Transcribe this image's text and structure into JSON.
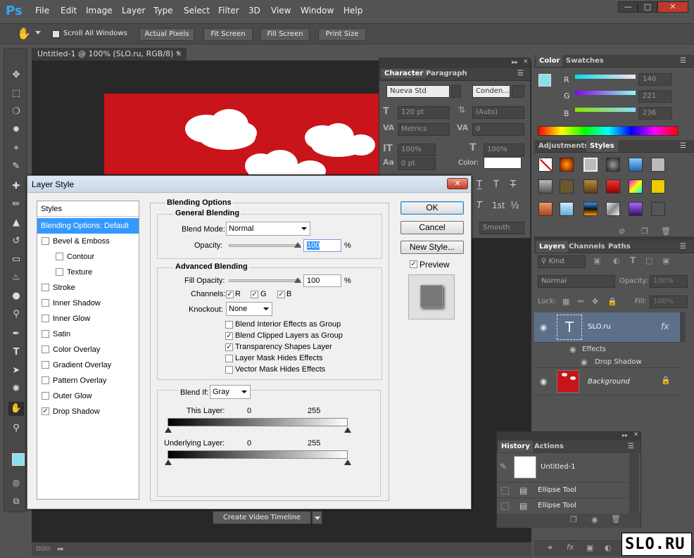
{
  "app": {
    "logo": "Ps",
    "menu": [
      "File",
      "Edit",
      "Image",
      "Layer",
      "Type",
      "Select",
      "Filter",
      "3D",
      "View",
      "Window",
      "Help"
    ]
  },
  "options_bar": {
    "scroll_all_label": "Scroll All Windows",
    "buttons": [
      "Actual Pixels",
      "Fit Screen",
      "Fill Screen",
      "Print Size"
    ]
  },
  "document": {
    "tab_title": "Untitled-1 @ 100% (SLO.ru, RGB/8) *",
    "create_video_label": "Create Video Timeline"
  },
  "character_panel": {
    "tabs": [
      "Character",
      "Paragraph"
    ],
    "font_family": "Nueva Std",
    "font_style": "Conden...",
    "size": "120 pt",
    "leading": "(Auto)",
    "kerning": "Metrics",
    "tracking": "0",
    "vscale": "100%",
    "hscale": "100%",
    "baseline": "0 pt",
    "color_label": "Color:",
    "smooth": "Smooth",
    "glyphs": [
      "T̲",
      "T",
      "T̶"
    ],
    "glyphs2": [
      "T",
      "1st",
      "½"
    ]
  },
  "color_panel": {
    "tabs": [
      "Color",
      "Swatches"
    ],
    "r_label": "R",
    "g_label": "G",
    "b_label": "B",
    "r": "140",
    "g": "221",
    "b": "236"
  },
  "styles_panel": {
    "tabs": [
      "Adjustments",
      "Styles"
    ]
  },
  "layers_panel": {
    "tabs": [
      "Layers",
      "Channels",
      "Paths"
    ],
    "kind": "Kind",
    "blend_mode": "Normal",
    "opacity_label": "Opacity:",
    "opacity": "100%",
    "lock_label": "Lock:",
    "fill_label": "Fill:",
    "fill": "100%",
    "layers": [
      {
        "name": "SLO.ru",
        "fx": "fx"
      },
      {
        "name": "Effects"
      },
      {
        "name": "Drop Shadow"
      },
      {
        "name": "Background"
      }
    ]
  },
  "history_panel": {
    "tabs": [
      "History",
      "Actions"
    ],
    "snapshot": "Untitled-1",
    "items": [
      "Ellipse Tool",
      "Ellipse Tool"
    ]
  },
  "dialog": {
    "title": "Layer Style",
    "styles_header": "Styles",
    "styles": [
      {
        "label": "Blending Options: Default",
        "checked": false,
        "selected": true,
        "checkbox": false
      },
      {
        "label": "Bevel & Emboss",
        "checked": false
      },
      {
        "label": "Contour",
        "checked": false,
        "indent": true
      },
      {
        "label": "Texture",
        "checked": false,
        "indent": true
      },
      {
        "label": "Stroke",
        "checked": false
      },
      {
        "label": "Inner Shadow",
        "checked": false
      },
      {
        "label": "Inner Glow",
        "checked": false
      },
      {
        "label": "Satin",
        "checked": false
      },
      {
        "label": "Color Overlay",
        "checked": false
      },
      {
        "label": "Gradient Overlay",
        "checked": false
      },
      {
        "label": "Pattern Overlay",
        "checked": false
      },
      {
        "label": "Outer Glow",
        "checked": false
      },
      {
        "label": "Drop Shadow",
        "checked": true
      }
    ],
    "blending_options_title": "Blending Options",
    "general_blending_title": "General Blending",
    "blend_mode_label": "Blend Mode:",
    "blend_mode": "Normal",
    "opacity_label": "Opacity:",
    "opacity": "100",
    "percent": "%",
    "advanced_title": "Advanced Blending",
    "fill_opacity_label": "Fill Opacity:",
    "fill_opacity": "100",
    "channels_label": "Channels:",
    "channel_r": "R",
    "channel_g": "G",
    "channel_b": "B",
    "knockout_label": "Knockout:",
    "knockout": "None",
    "options": [
      {
        "label": "Blend Interior Effects as Group",
        "checked": false
      },
      {
        "label": "Blend Clipped Layers as Group",
        "checked": true
      },
      {
        "label": "Transparency Shapes Layer",
        "checked": true
      },
      {
        "label": "Layer Mask Hides Effects",
        "checked": false
      },
      {
        "label": "Vector Mask Hides Effects",
        "checked": false
      }
    ],
    "blend_if_label": "Blend If:",
    "blend_if": "Gray",
    "this_layer_label": "This Layer:",
    "this_layer_min": "0",
    "this_layer_max": "255",
    "underlying_label": "Underlying Layer:",
    "underlying_min": "0",
    "underlying_max": "255",
    "ok": "OK",
    "cancel": "Cancel",
    "new_style": "New Style...",
    "preview": "Preview"
  },
  "watermark": "SLO.RU"
}
